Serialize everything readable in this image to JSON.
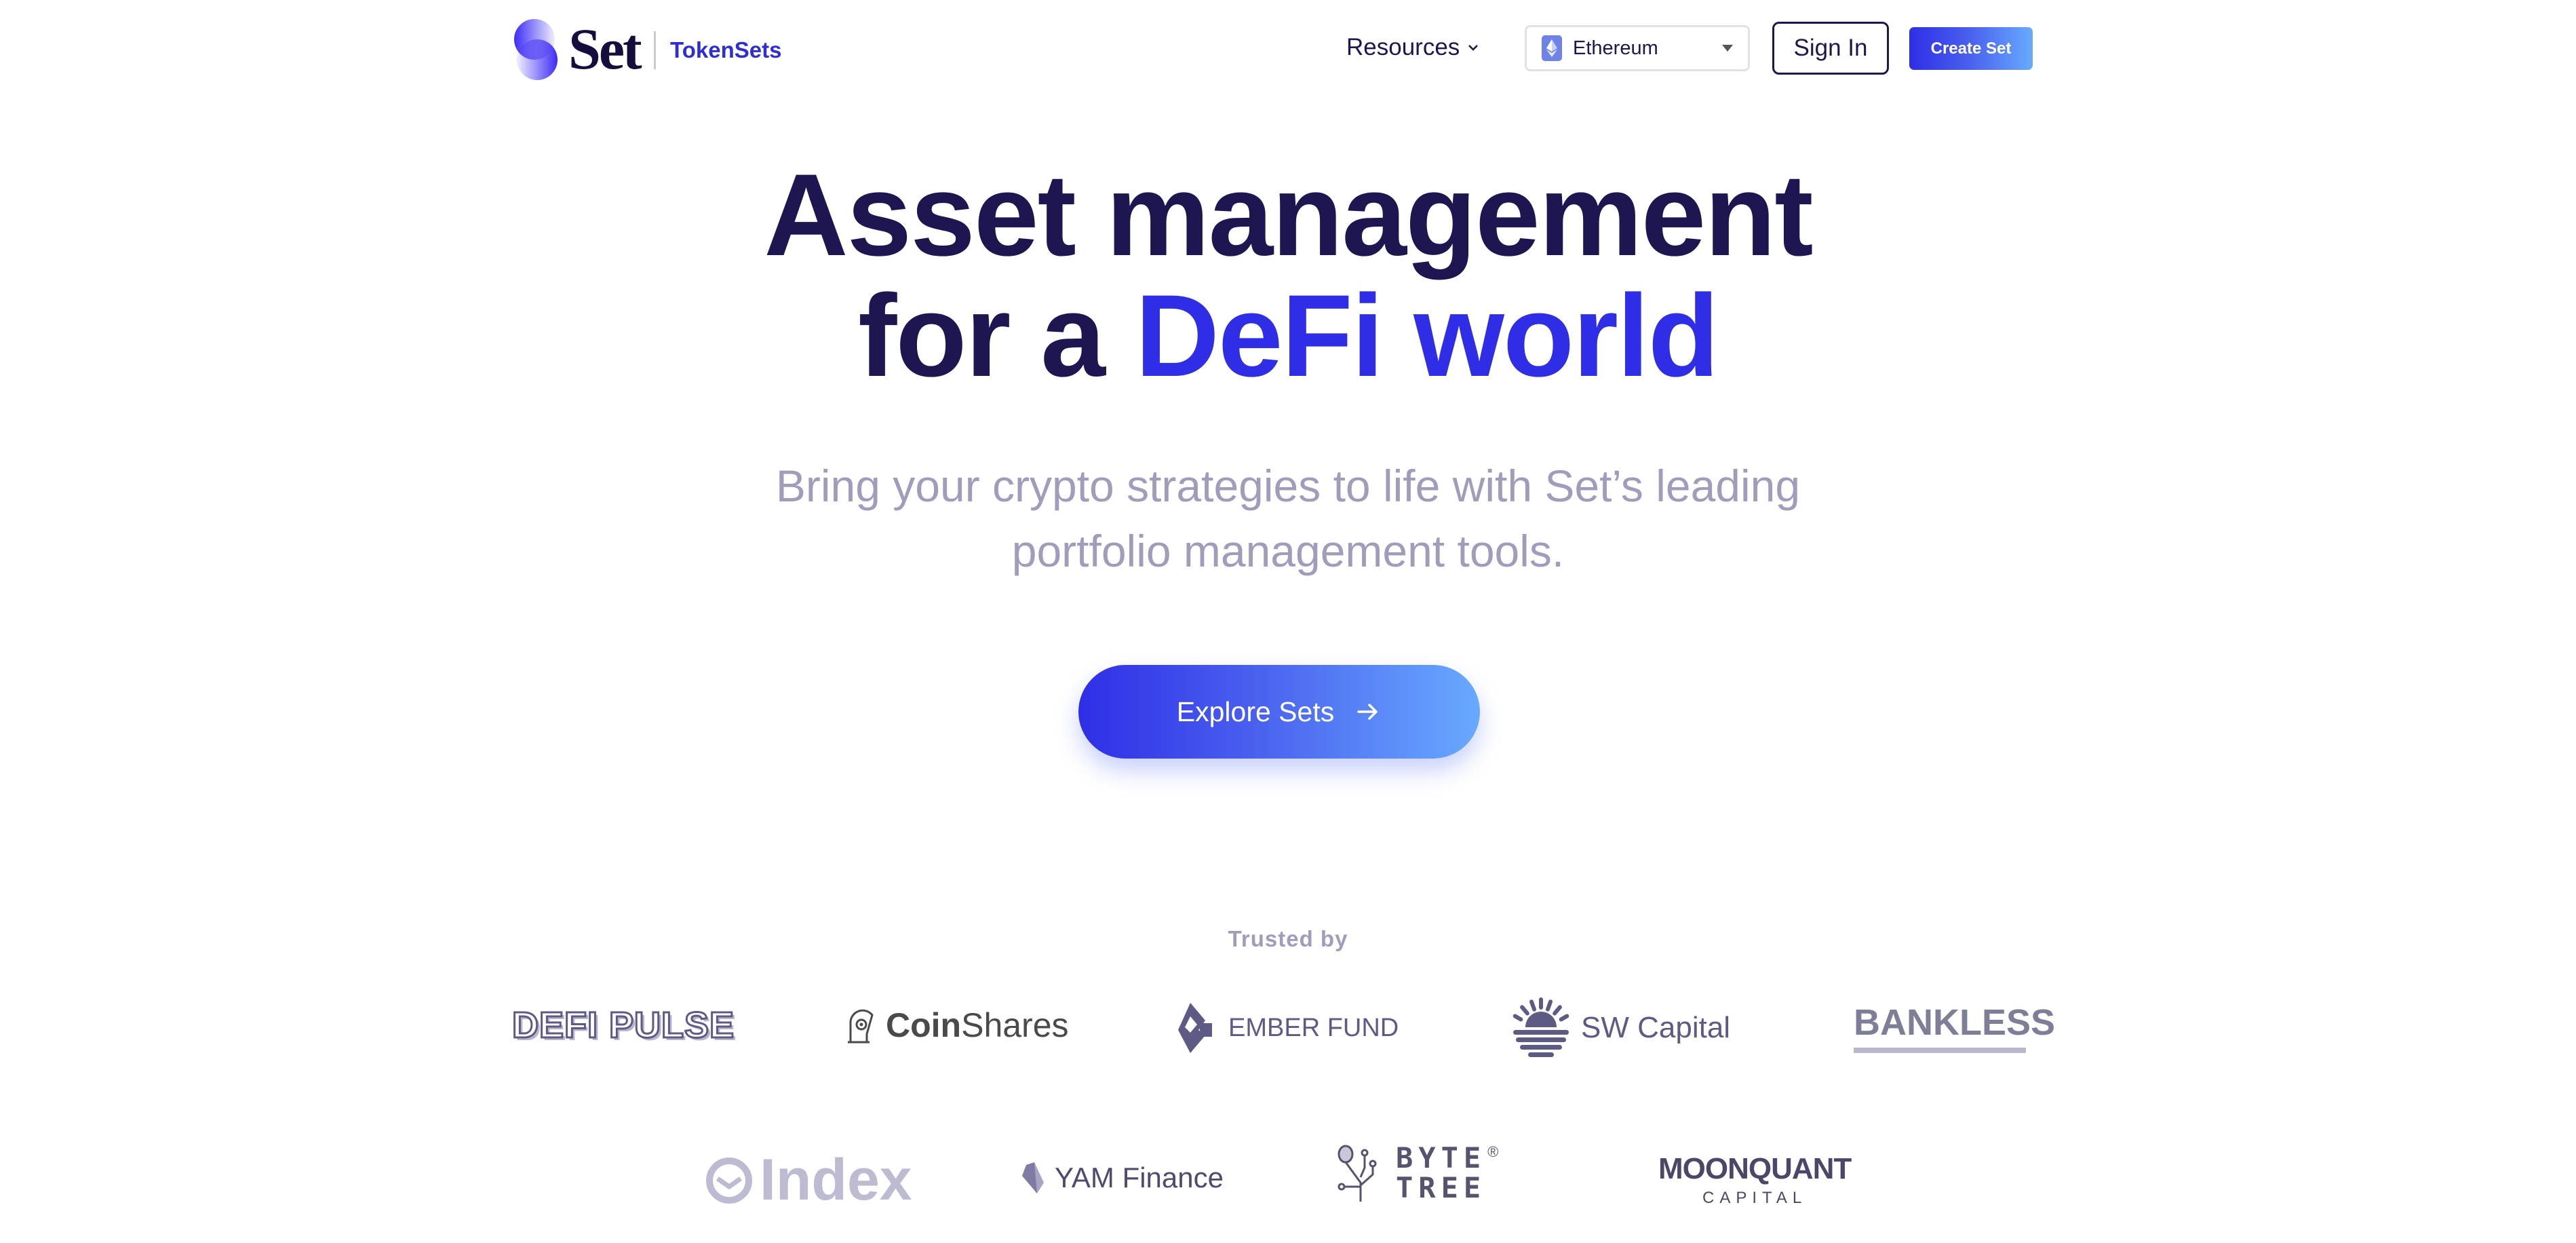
{
  "header": {
    "logo_wordmark": "Set",
    "product_name": "TokenSets",
    "nav": {
      "resources_label": "Resources"
    },
    "network_select": {
      "selected": "Ethereum",
      "icon": "ethereum-icon"
    },
    "sign_in_label": "Sign In",
    "create_set_label": "Create Set"
  },
  "hero": {
    "headline_line1": "Asset management",
    "headline_line2_prefix": "for a ",
    "headline_line2_accent": "DeFi world",
    "subtitle_line1": "Bring your crypto strategies to life with Set’s leading",
    "subtitle_line2": "portfolio management tools.",
    "cta_label": "Explore Sets",
    "cta_icon": "arrow-right-icon"
  },
  "trusted": {
    "label": "Trusted by",
    "row1": [
      {
        "name": "DEFI PULSE"
      },
      {
        "name_bold": "Coin",
        "name_light": "Shares"
      },
      {
        "name": "EMBER FUND"
      },
      {
        "name": "SW Capital"
      },
      {
        "name": "BANKLESS"
      }
    ],
    "row2": [
      {
        "name": "Index"
      },
      {
        "name": "YAM Finance"
      },
      {
        "name_line1": "BYTE",
        "name_line2": "TREE",
        "mark": "®"
      },
      {
        "name_line1": "MOONQUANT",
        "name_line2": "CAPITAL"
      }
    ]
  },
  "colors": {
    "navy": "#1e1650",
    "accent_blue": "#2f2ee6",
    "gradient_end": "#68aaff",
    "muted_text": "#a09cbb",
    "logo_gray": "#5e5a86"
  }
}
